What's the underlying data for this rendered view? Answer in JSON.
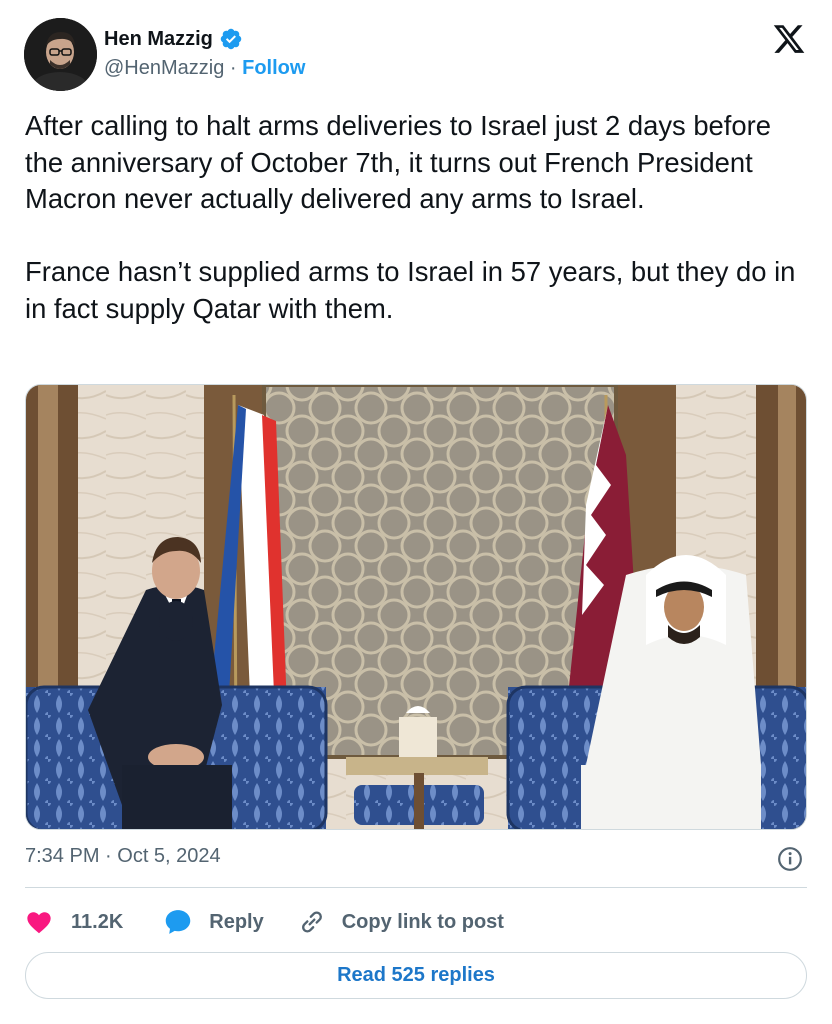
{
  "author": {
    "name": "Hen Mazzig",
    "handle": "@HenMazzig",
    "separator": " · ",
    "follow_label": "Follow",
    "verified": true
  },
  "tweet": {
    "text": "After calling to halt arms deliveries to Israel just 2 days before the anniversary of October 7th, it turns out French President Macron never actually delivered any arms to Israel.\n\nFrance hasn’t supplied arms to Israel in 57 years, but they do in in fact supply Qatar with them.",
    "timestamp": "7:34 PM · Oct 5, 2024"
  },
  "actions": {
    "like_count": "11.2K",
    "reply_label": "Reply",
    "copy_label": "Copy link to post"
  },
  "read_replies_label": "Read 525 replies",
  "icons": {
    "platform": "x-logo-icon",
    "verified": "verified-badge-icon",
    "like": "heart-icon",
    "reply": "speech-bubble-icon",
    "copy": "link-icon",
    "info": "info-icon"
  },
  "colors": {
    "accent": "#1d9bf0",
    "like": "#f91880",
    "secondary_text": "#536471",
    "border": "#cfd9de"
  }
}
